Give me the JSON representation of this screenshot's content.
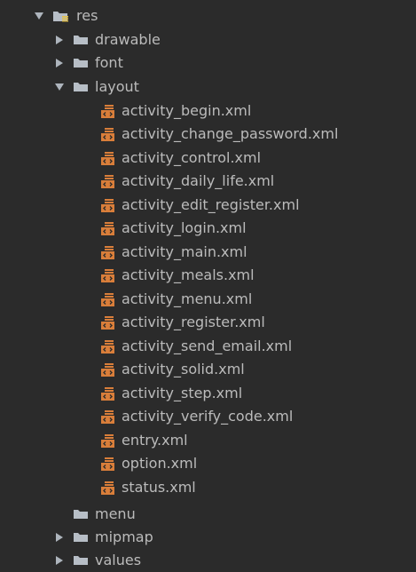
{
  "root": {
    "label": "res",
    "expanded": true,
    "icon": "resource-folder-icon"
  },
  "folders": [
    {
      "key": "drawable",
      "label": "drawable",
      "expanded": false
    },
    {
      "key": "font",
      "label": "font",
      "expanded": false
    },
    {
      "key": "layout",
      "label": "layout",
      "expanded": true
    },
    {
      "key": "menu",
      "label": "menu",
      "expanded": false
    },
    {
      "key": "mipmap",
      "label": "mipmap",
      "expanded": false
    },
    {
      "key": "values",
      "label": "values",
      "expanded": false
    }
  ],
  "layout_files": [
    "activity_begin.xml",
    "activity_change_password.xml",
    "activity_control.xml",
    "activity_daily_life.xml",
    "activity_edit_register.xml",
    "activity_login.xml",
    "activity_main.xml",
    "activity_meals.xml",
    "activity_menu.xml",
    "activity_register.xml",
    "activity_send_email.xml",
    "activity_solid.xml",
    "activity_step.xml",
    "activity_verify_code.xml",
    "entry.xml",
    "option.xml",
    "status.xml"
  ],
  "colors": {
    "background": "#2b2b2b",
    "text": "#bbbbbb",
    "arrow": "#aeb5bd",
    "folder": "#b7bec6",
    "xml_orange": "#d97e3a"
  }
}
